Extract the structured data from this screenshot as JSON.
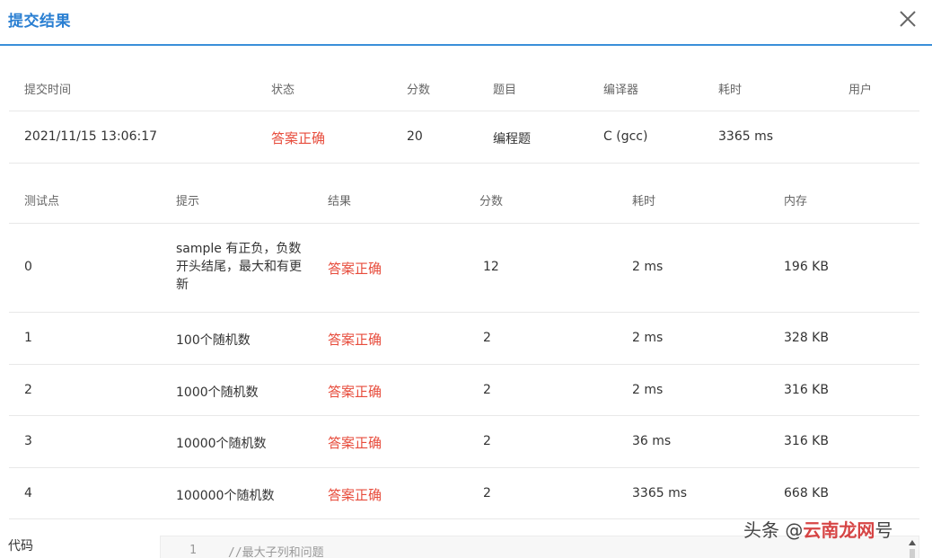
{
  "dialog": {
    "title": "提交结果"
  },
  "summary": {
    "headers": [
      "提交时间",
      "状态",
      "分数",
      "题目",
      "编译器",
      "耗时",
      "用户"
    ],
    "row": {
      "time": "2021/11/15 13:06:17",
      "status": "答案正确",
      "score": "20",
      "problem": "编程题",
      "compiler": "C (gcc)",
      "elapsed": "3365 ms",
      "user": ""
    }
  },
  "cases": {
    "headers": [
      "测试点",
      "提示",
      "结果",
      "分数",
      "耗时",
      "内存"
    ],
    "rows": [
      {
        "id": "0",
        "hint": "sample 有正负，负数开头结尾，最大和有更新",
        "result": "答案正确",
        "score": "12",
        "time": "2 ms",
        "memory": "196 KB"
      },
      {
        "id": "1",
        "hint": "100个随机数",
        "result": "答案正确",
        "score": "2",
        "time": "2 ms",
        "memory": "328 KB"
      },
      {
        "id": "2",
        "hint": "1000个随机数",
        "result": "答案正确",
        "score": "2",
        "time": "2 ms",
        "memory": "316 KB"
      },
      {
        "id": "3",
        "hint": "10000个随机数",
        "result": "答案正确",
        "score": "2",
        "time": "36 ms",
        "memory": "316 KB"
      },
      {
        "id": "4",
        "hint": "100000个随机数",
        "result": "答案正确",
        "score": "2",
        "time": "3365 ms",
        "memory": "668 KB"
      }
    ]
  },
  "code": {
    "label": "代码",
    "line_number": "1",
    "line_text": "//最大子列和问题"
  },
  "watermark": {
    "prefix": "头条 @",
    "brand": "云南龙网",
    "suffix": "号"
  },
  "colors": {
    "accent": "#2a7fd2",
    "header_line": "#3a8fd9",
    "ok": "#e74c3c"
  }
}
